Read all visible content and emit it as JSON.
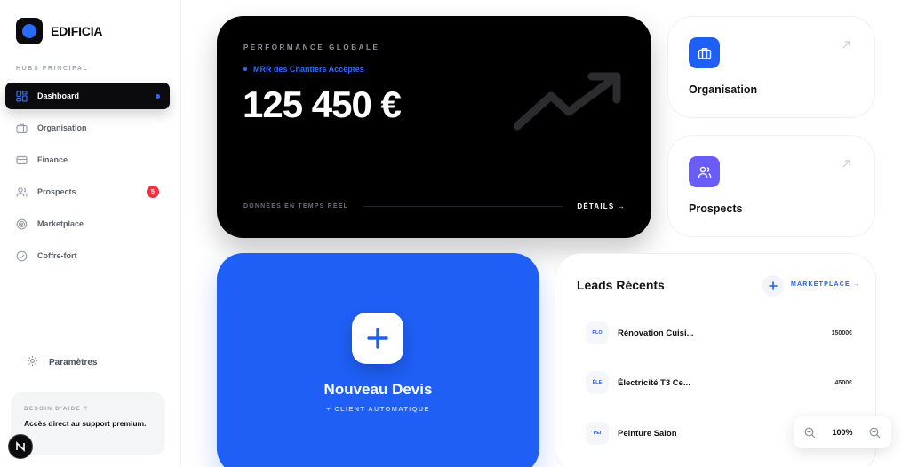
{
  "brand": {
    "name": "EDIFICIA"
  },
  "sidebar": {
    "section_label": "HUBS PRINCIPAL",
    "items": [
      {
        "label": "Dashboard",
        "icon": "grid-icon",
        "active": true
      },
      {
        "label": "Organisation",
        "icon": "briefcase-icon"
      },
      {
        "label": "Finance",
        "icon": "card-icon"
      },
      {
        "label": "Prospects",
        "icon": "users-icon",
        "badge": "5"
      },
      {
        "label": "Marketplace",
        "icon": "target-icon"
      },
      {
        "label": "Coffre-fort",
        "icon": "check-circle-icon"
      }
    ],
    "settings_label": "Paramètres",
    "help": {
      "title": "BESOIN D'AIDE ?",
      "text": "Accès direct au support premium."
    },
    "avatar_letter": "N"
  },
  "performance": {
    "label": "PERFORMANCE GLOBALE",
    "subtitle": "MRR des Chantiers Acceptés",
    "value": "125 450 €",
    "footer": "DONNÉES EN TEMPS RÉEL",
    "details": "DÉTAILS →"
  },
  "cards": {
    "organisation": "Organisation",
    "prospects": "Prospects"
  },
  "new_quote": {
    "title": "Nouveau Devis",
    "subtitle": "+ CLIENT AUTOMATIQUE"
  },
  "leads": {
    "title": "Leads Récents",
    "marketplace": "MARKETPLACE →",
    "rows": [
      {
        "code": "PLO",
        "name": "Rénovation Cuisi...",
        "price": "15000€"
      },
      {
        "code": "ÉLE",
        "name": "Électricité T3 Ce...",
        "price": "4500€"
      },
      {
        "code": "PEI",
        "name": "Peinture Salon",
        "price": ""
      }
    ]
  },
  "zoom": {
    "value": "100%"
  },
  "colors": {
    "accent": "#1f5ff5",
    "dark": "#0b0b0d",
    "badge": "#ef3340",
    "violet": "#6a5cf6"
  }
}
